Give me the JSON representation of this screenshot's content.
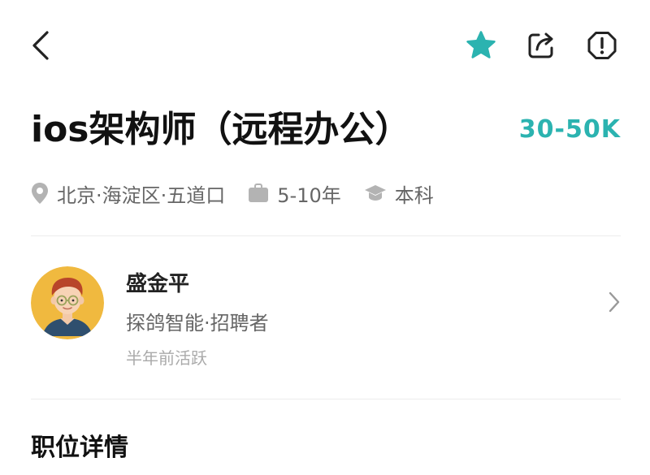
{
  "colors": {
    "accent": "#2bb3b0",
    "text_primary": "#111111",
    "text_secondary": "#666666",
    "text_muted": "#aaaaaa"
  },
  "topbar": {
    "back_icon": "chevron-left-icon",
    "actions": [
      {
        "icon": "star-icon",
        "state": "favorited"
      },
      {
        "icon": "share-icon"
      },
      {
        "icon": "warning-icon"
      }
    ]
  },
  "job": {
    "title": "ios架构师（远程办公）",
    "salary": "30-50K",
    "location": "北京·海淀区·五道口",
    "experience": "5-10年",
    "education": "本科"
  },
  "recruiter": {
    "name": "盛金平",
    "company_role": "探鸽智能·招聘者",
    "active_status": "半年前活跃"
  },
  "sections": {
    "job_details_title": "职位详情"
  }
}
